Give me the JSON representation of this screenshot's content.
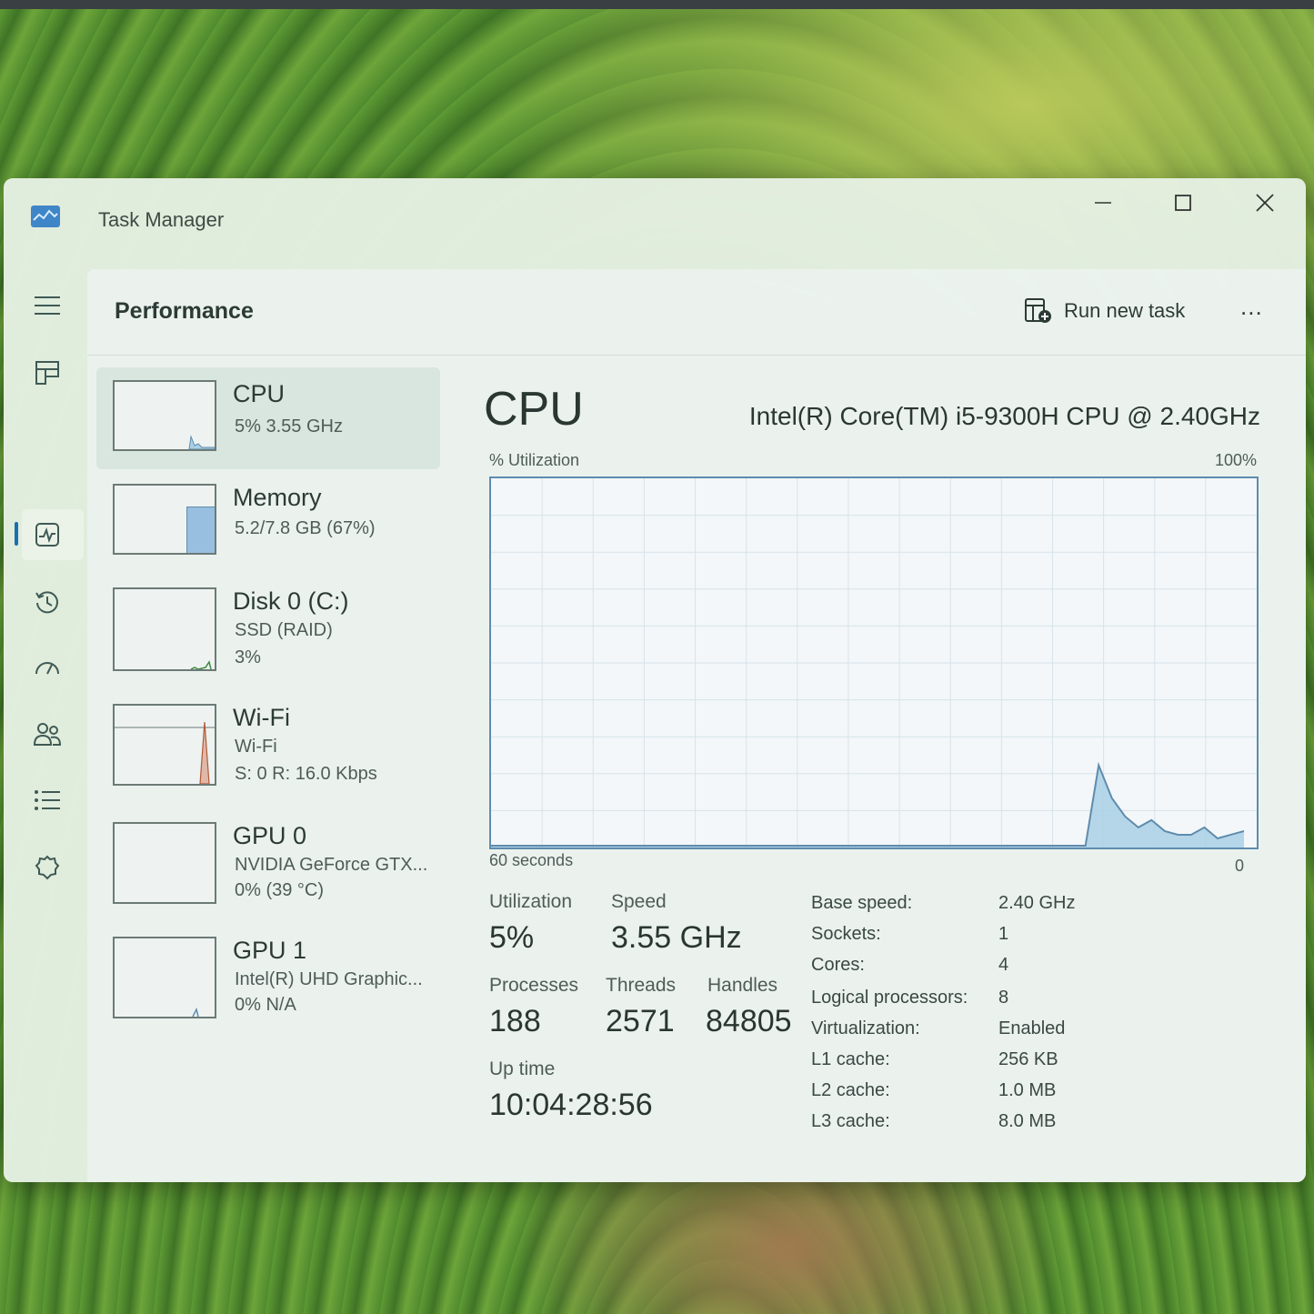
{
  "window": {
    "title": "Task Manager"
  },
  "header": {
    "page_title": "Performance",
    "run_new_task": "Run new task",
    "more": "..."
  },
  "sidebar_items": [
    {
      "name": "CPU",
      "line1": "5% 3.55 GHz",
      "line2": ""
    },
    {
      "name": "Memory",
      "line1": "5.2/7.8 GB (67%)",
      "line2": ""
    },
    {
      "name": "Disk 0 (C:)",
      "line1": "SSD (RAID)",
      "line2": "3%"
    },
    {
      "name": "Wi-Fi",
      "line1": "Wi-Fi",
      "line2": "S: 0 R: 16.0 Kbps"
    },
    {
      "name": "GPU 0",
      "line1": "NVIDIA GeForce GTX...",
      "line2": "0% (39 °C)"
    },
    {
      "name": "GPU 1",
      "line1": "Intel(R) UHD Graphic...",
      "line2": "0% N/A"
    }
  ],
  "detail": {
    "title": "CPU",
    "model": "Intel(R) Core(TM) i5-9300H CPU @ 2.40GHz",
    "graph_label": "% Utilization",
    "graph_max": "100%",
    "graph_time": "60 seconds",
    "graph_min": "0",
    "utilization_label": "Utilization",
    "utilization": "5%",
    "speed_label": "Speed",
    "speed": "3.55 GHz",
    "processes_label": "Processes",
    "processes": "188",
    "threads_label": "Threads",
    "threads": "2571",
    "handles_label": "Handles",
    "handles": "84805",
    "uptime_label": "Up time",
    "uptime": "10:04:28:56",
    "specs": [
      {
        "label": "Base speed:",
        "value": "2.40 GHz"
      },
      {
        "label": "Sockets:",
        "value": "1"
      },
      {
        "label": "Cores:",
        "value": "4"
      },
      {
        "label": "Logical processors:",
        "value": "8"
      },
      {
        "label": "Virtualization:",
        "value": "Enabled"
      },
      {
        "label": "L1 cache:",
        "value": "256 KB"
      },
      {
        "label": "L2 cache:",
        "value": "1.0 MB"
      },
      {
        "label": "L3 cache:",
        "value": "8.0 MB"
      }
    ]
  },
  "chart_data": {
    "type": "area",
    "ylim": [
      0,
      100
    ],
    "values": [
      0,
      0,
      0,
      0,
      0,
      0,
      0,
      0,
      0,
      0,
      0,
      0,
      0,
      0,
      0,
      0,
      0,
      0,
      0,
      0,
      0,
      0,
      0,
      0,
      0,
      0,
      0,
      0,
      0,
      0,
      0,
      0,
      0,
      0,
      0,
      0,
      0,
      0,
      0,
      0,
      0,
      0,
      0,
      0,
      0,
      0,
      22,
      13,
      8,
      5,
      7,
      4,
      3,
      3,
      5,
      2,
      3,
      4
    ]
  },
  "colors": {
    "accent": "#1a6fb0",
    "graph_line": "#5f8cad",
    "graph_fill": "#a9d0e6"
  }
}
